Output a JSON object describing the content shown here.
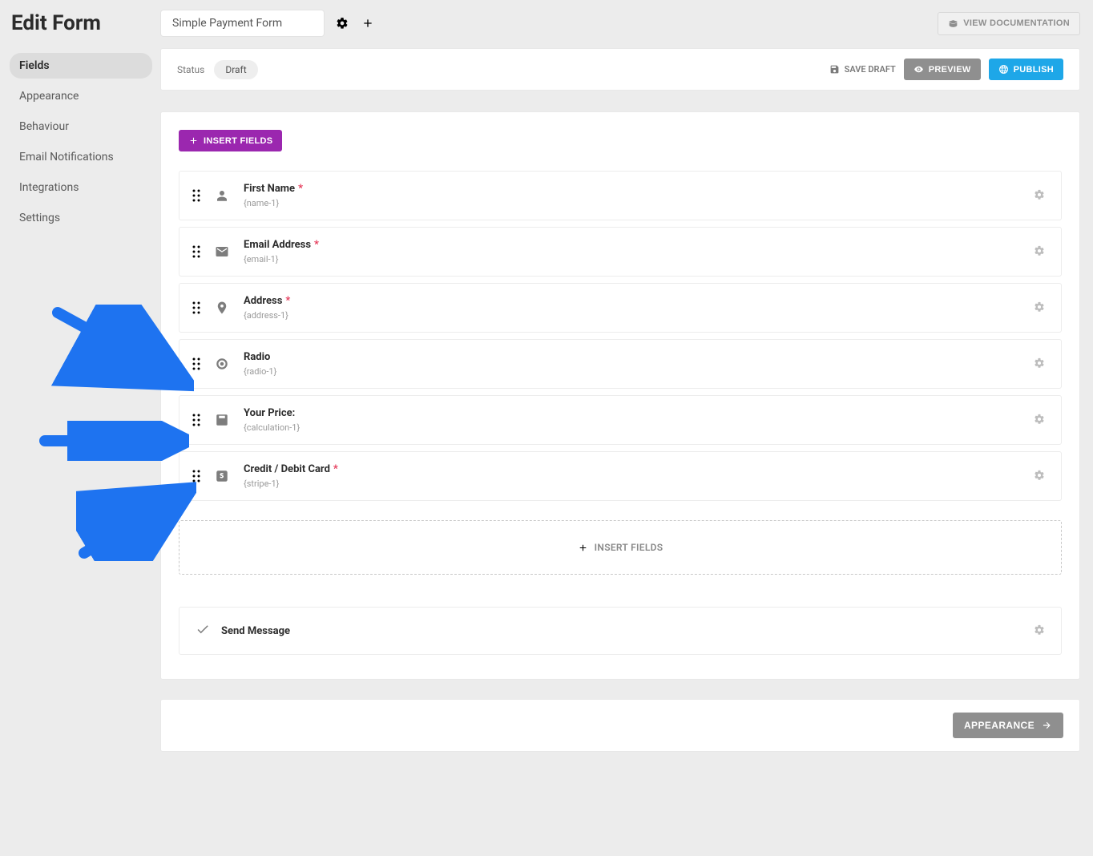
{
  "page_title": "Edit Form",
  "form_title": "Simple Payment Form",
  "view_doc_label": "VIEW DOCUMENTATION",
  "sidebar": {
    "items": [
      {
        "label": "Fields",
        "active": true
      },
      {
        "label": "Appearance",
        "active": false
      },
      {
        "label": "Behaviour",
        "active": false
      },
      {
        "label": "Email Notifications",
        "active": false
      },
      {
        "label": "Integrations",
        "active": false
      },
      {
        "label": "Settings",
        "active": false
      }
    ]
  },
  "status_bar": {
    "label": "Status",
    "value": "Draft",
    "save_draft_label": "SAVE DRAFT",
    "preview_label": "PREVIEW",
    "publish_label": "PUBLISH"
  },
  "toolbar": {
    "insert_fields_label": "INSERT FIELDS"
  },
  "fields": [
    {
      "icon": "user",
      "title": "First Name",
      "required": true,
      "slug": "{name-1}"
    },
    {
      "icon": "mail",
      "title": "Email Address",
      "required": true,
      "slug": "{email-1}"
    },
    {
      "icon": "pin",
      "title": "Address",
      "required": true,
      "slug": "{address-1}"
    },
    {
      "icon": "radio",
      "title": "Radio",
      "required": false,
      "slug": "{radio-1}"
    },
    {
      "icon": "calc",
      "title": "Your Price:",
      "required": false,
      "slug": "{calculation-1}"
    },
    {
      "icon": "stripe",
      "title": "Credit / Debit Card",
      "required": true,
      "slug": "{stripe-1}"
    }
  ],
  "drop_zone_label": "INSERT FIELDS",
  "actions": {
    "send_message_label": "Send Message"
  },
  "footer": {
    "next_label": "APPEARANCE"
  }
}
